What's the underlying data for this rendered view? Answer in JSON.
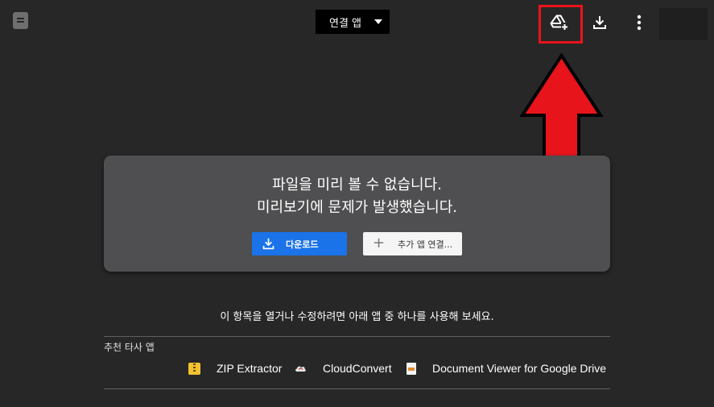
{
  "header": {
    "open_with_label": "연결 앱",
    "icons": [
      "file-type-icon",
      "add-to-drive-icon",
      "download-icon",
      "more-vert-icon"
    ]
  },
  "preview": {
    "line1": "파일을 미리 볼 수 없습니다.",
    "line2": "미리보기에 문제가 발생했습니다.",
    "download_label": "다운로드",
    "connect_label": "추가 앱 연결..."
  },
  "hint": "이 항목을 열거나 수정하려면 아래 앱 중 하나를 사용해 보세요.",
  "recommended": {
    "label": "추천 타사 앱",
    "apps": [
      {
        "name": "ZIP Extractor",
        "icon": "zip-extractor-icon"
      },
      {
        "name": "CloudConvert",
        "icon": "cloudconvert-icon"
      },
      {
        "name": "Document Viewer for Google Drive",
        "icon": "document-viewer-icon"
      }
    ]
  },
  "colors": {
    "background": "#272727",
    "card": "#4f4e50",
    "primary_button": "#1a73e8",
    "highlight": "#e8141c"
  }
}
